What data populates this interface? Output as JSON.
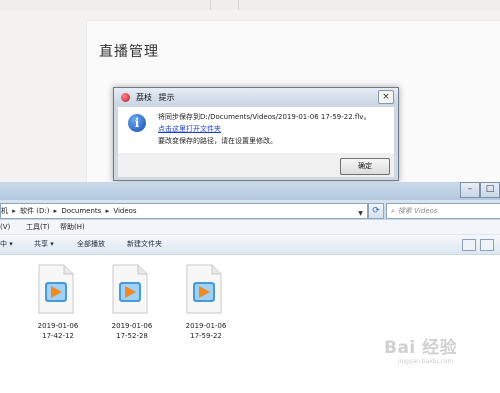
{
  "background_app": {
    "panel_title": "直播管理"
  },
  "dialog": {
    "app_name": "荔枝",
    "title": "提示",
    "line1": "将同步保存到D:/Documents/Videos/2019-01-06 17-59-22.flv。",
    "link": "点击这里打开文件夹",
    "line3": "要改变保存的路径，请在设置里修改。",
    "ok_label": "确定",
    "close_glyph": "×",
    "info_glyph": "i"
  },
  "explorer": {
    "window_buttons": [
      "–",
      "□"
    ],
    "breadcrumb": [
      "机",
      "▸",
      "软件 (D:)",
      "▸",
      "Documents",
      "▸",
      "Videos"
    ],
    "search_placeholder": "搜索 Videos",
    "menu": [
      "(V)",
      "工具(T)",
      "帮助(H)"
    ],
    "toolbar": {
      "organize_partial": "中 ▾",
      "share": "共享 ▾",
      "play_all": "全部播放",
      "new_folder": "新建文件夹"
    },
    "files": [
      {
        "date": "2019-01-06",
        "time": "17-42-12"
      },
      {
        "date": "2019-01-06",
        "time": "17-52-28"
      },
      {
        "date": "2019-01-06",
        "time": "17-59-22"
      }
    ]
  },
  "watermark": {
    "main": "Bai 经验",
    "sub": "jingyan.baidu.com"
  },
  "colors": {
    "link": "#1a3ed6",
    "explorer_chrome": "#c9d9ea",
    "play_orange": "#f0891f",
    "media_blue": "#4a9ad8"
  }
}
